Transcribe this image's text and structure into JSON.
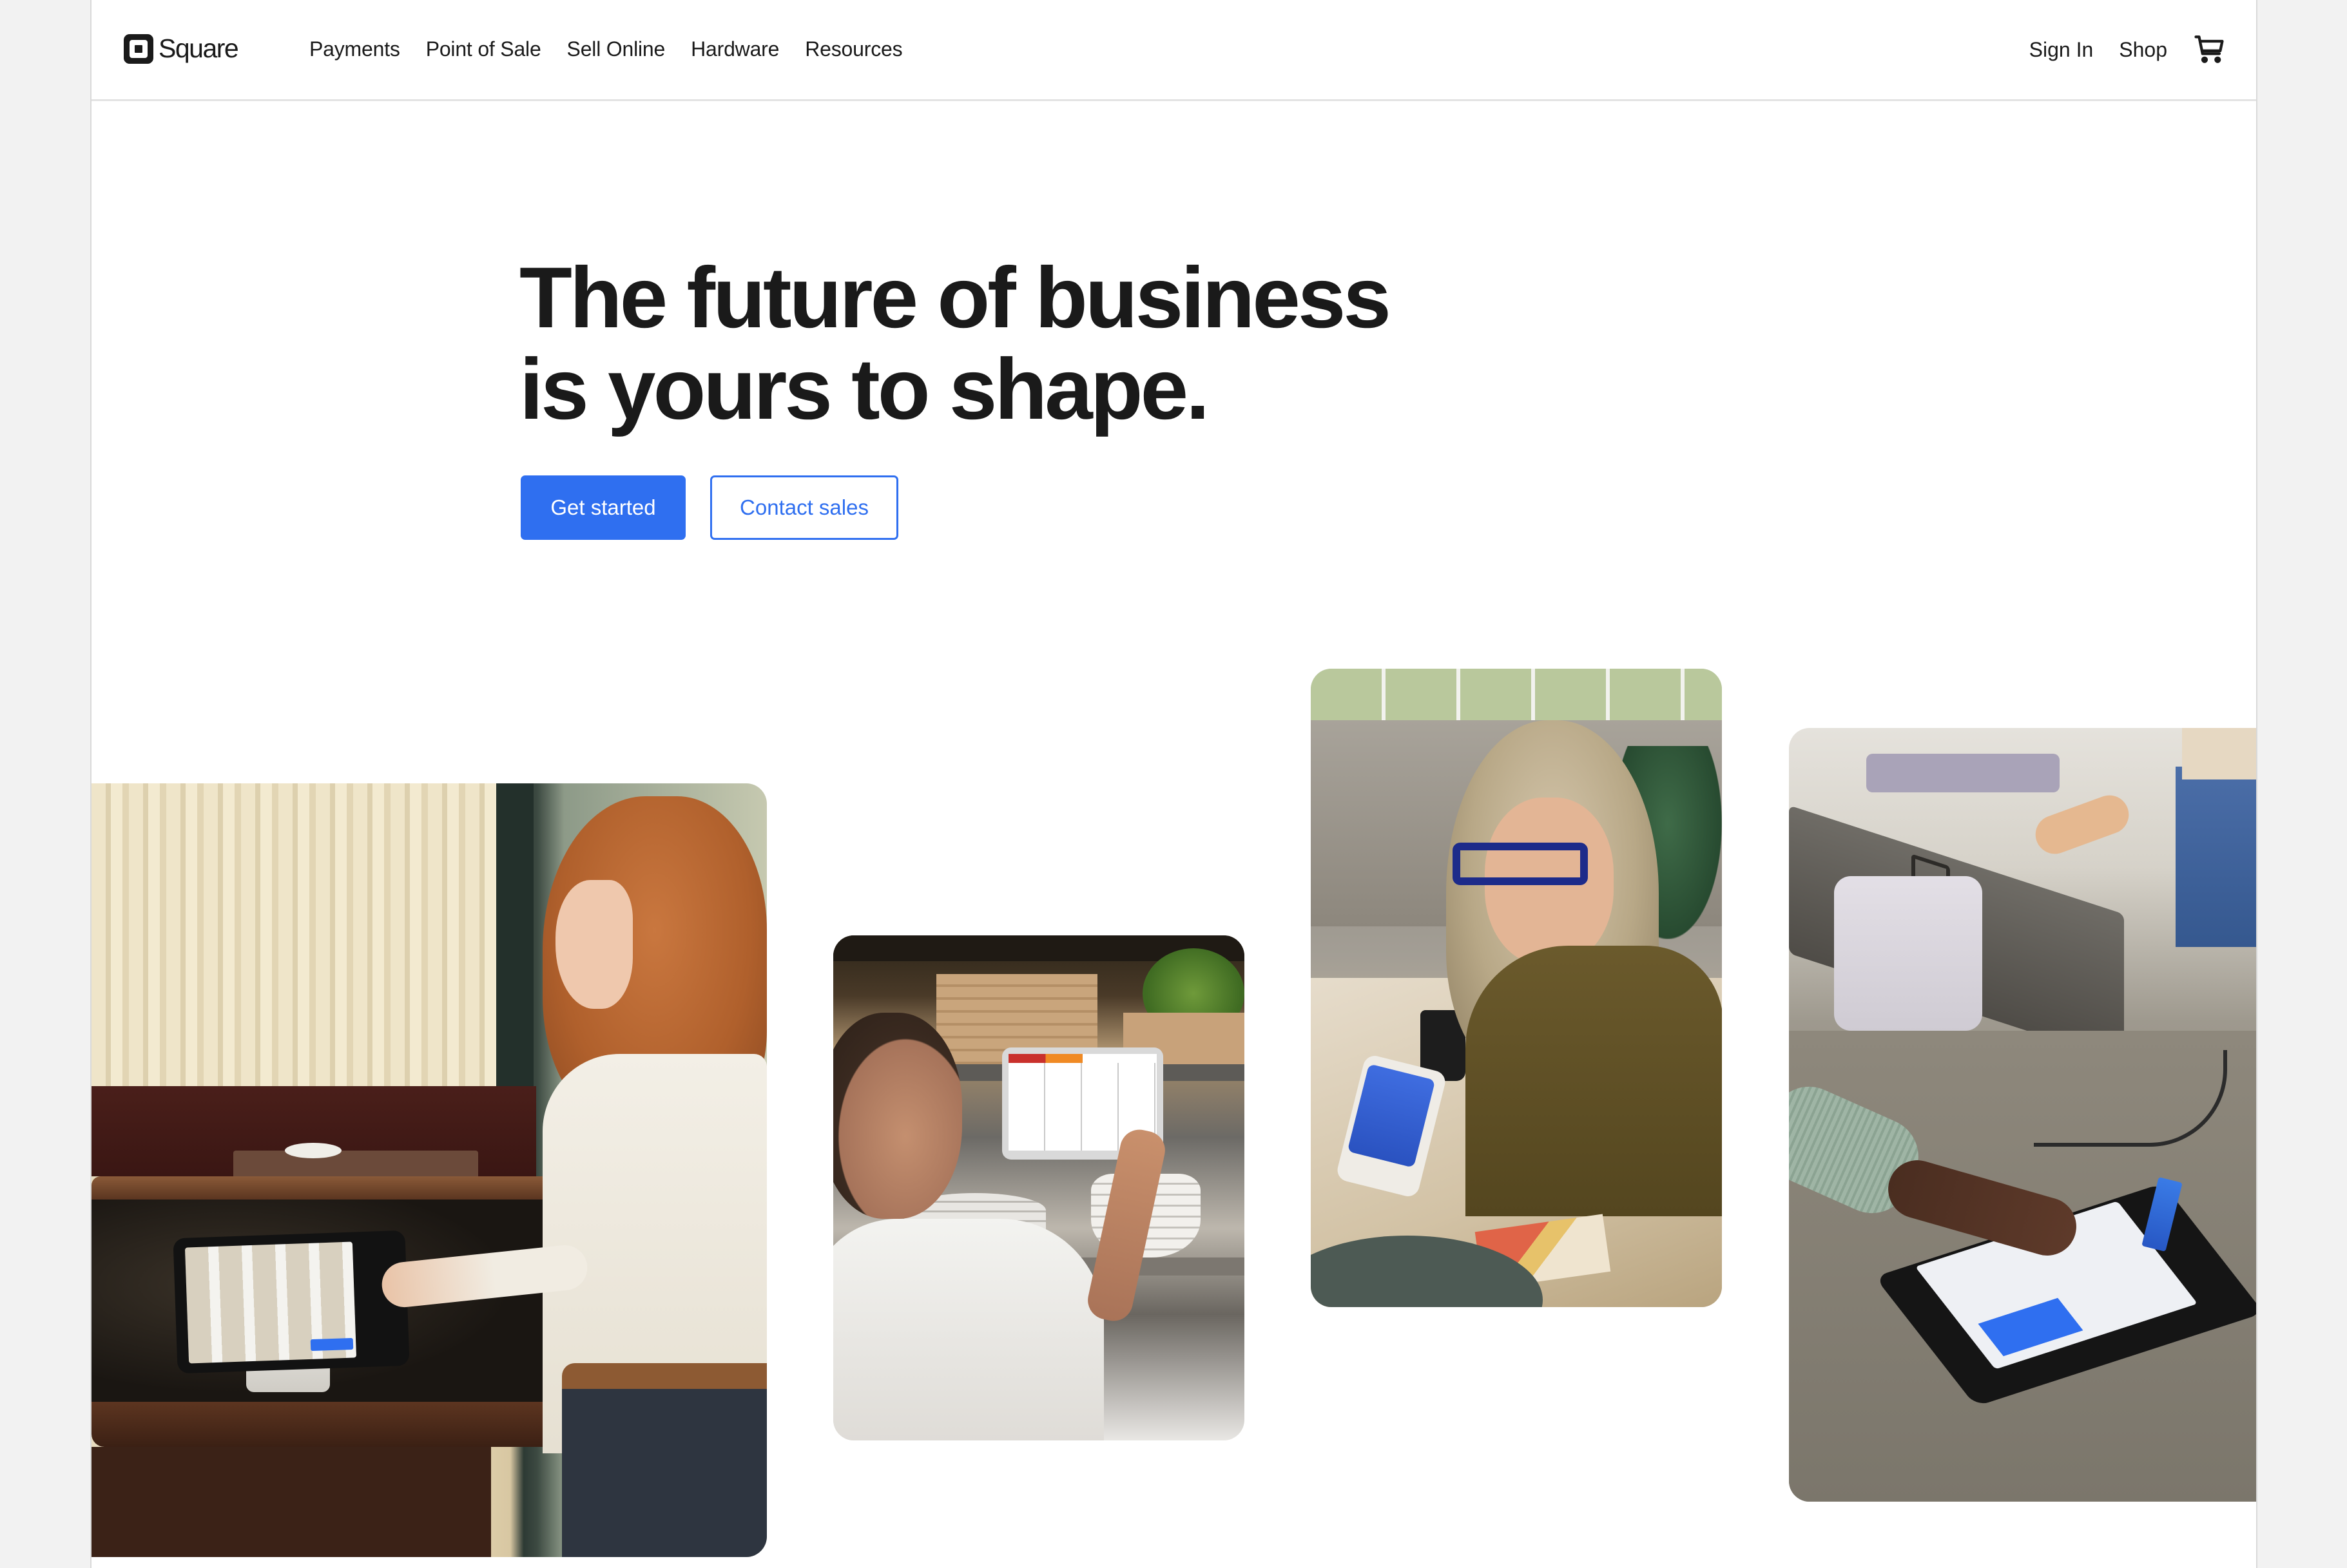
{
  "brand": {
    "name": "Square",
    "accent_color": "#2f6ff0",
    "text_color": "#1a1a1a"
  },
  "header": {
    "nav": [
      {
        "label": "Payments"
      },
      {
        "label": "Point of Sale"
      },
      {
        "label": "Sell Online"
      },
      {
        "label": "Hardware"
      },
      {
        "label": "Resources"
      }
    ],
    "sign_in_label": "Sign In",
    "shop_label": "Shop",
    "cart_icon": "shopping-cart-icon"
  },
  "hero": {
    "title_line1": "The future of business",
    "title_line2": "is yours to shape.",
    "primary_button": "Get started",
    "secondary_button": "Contact sales"
  },
  "gallery": [
    {
      "subject": "Server using a Square Register tablet on a stand in a restaurant"
    },
    {
      "subject": "Cook tapping a kitchen display screen of open orders"
    },
    {
      "subject": "Smiling woman holding a Square Terminal for a contactless payment"
    },
    {
      "subject": "Customer entering PIN on a Square Register customer display with a card inserted"
    }
  ]
}
